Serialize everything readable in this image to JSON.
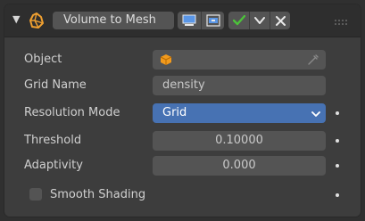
{
  "node": {
    "title": "Volume to Mesh",
    "header_icons": {
      "collapse": "collapse-arrow-icon",
      "node": "volume-mesh-node-icon",
      "viewer_a": "node-preview-icon",
      "viewer_b": "node-viewer-icon",
      "mute": "check-icon",
      "options": "chevron-down-icon",
      "close": "close-icon",
      "grip": "grip-dots-icon"
    }
  },
  "properties": {
    "object_label": "Object",
    "object_icon": "object-cube-icon",
    "object_picker_icon": "eyedropper-icon",
    "grid_name_label": "Grid Name",
    "grid_name_value": "density",
    "resolution_mode_label": "Resolution Mode",
    "resolution_mode_value": "Grid",
    "threshold_label": "Threshold",
    "threshold_value": "0.10000",
    "adaptivity_label": "Adaptivity",
    "adaptivity_value": "0.000",
    "smooth_shading_label": "Smooth Shading",
    "smooth_shading_checked": false
  },
  "colors": {
    "accent": "#4772b3",
    "check_green": "#4cc23a",
    "viewer_blue": "#5a96e6"
  }
}
